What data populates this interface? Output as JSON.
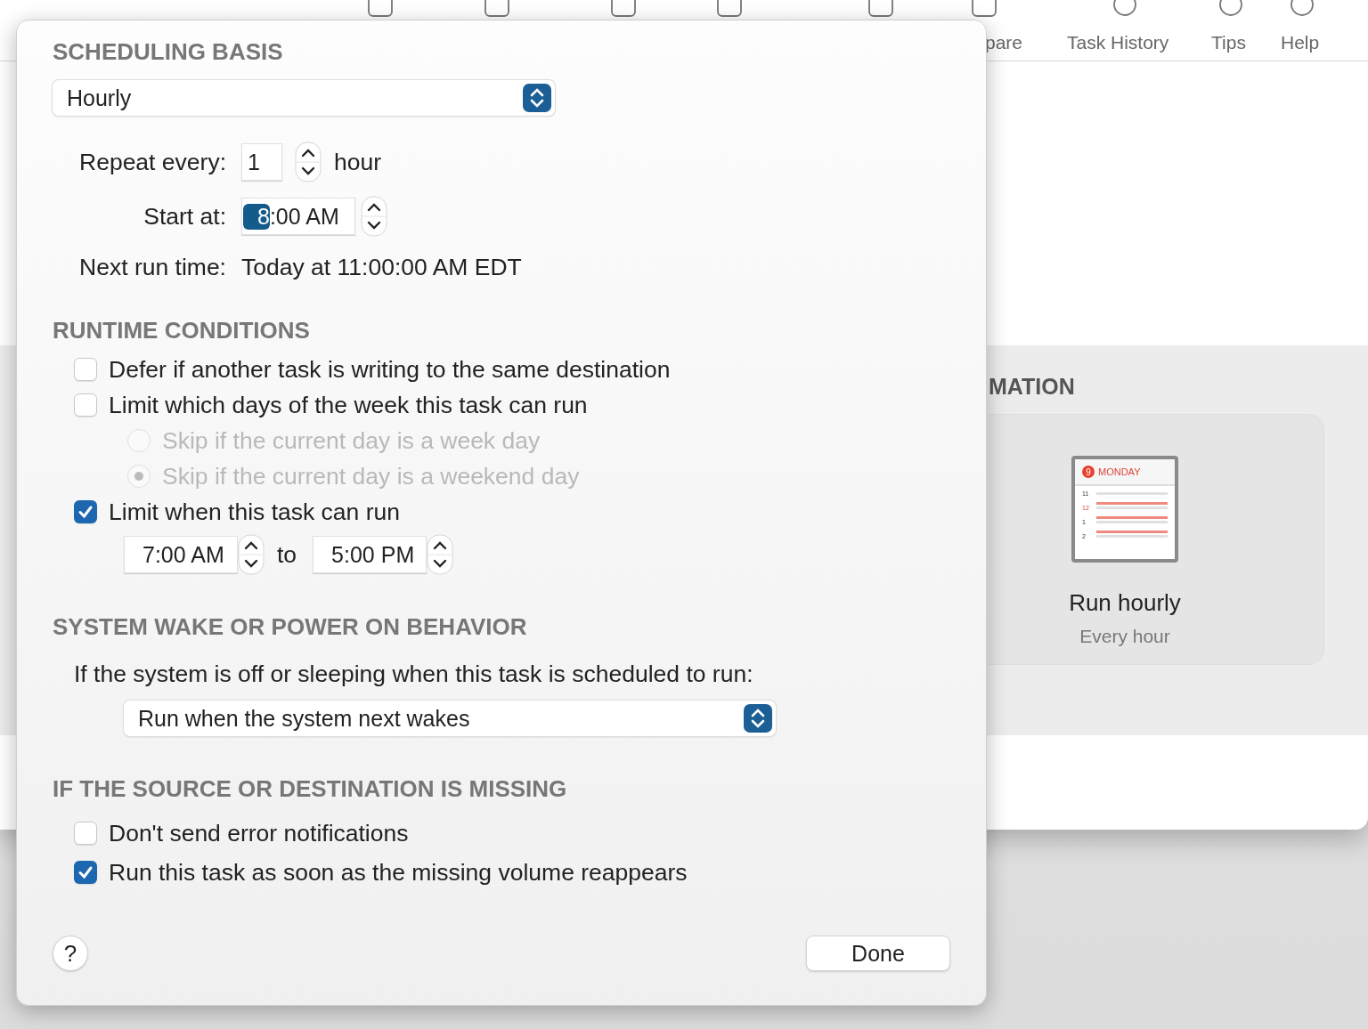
{
  "toolbar": {
    "labels": [
      "pare",
      "Task History",
      "Tips",
      "Help"
    ]
  },
  "background_panel": {
    "heading": "MATION",
    "card": {
      "calendar": {
        "badge": "9",
        "day": "MONDAY",
        "hours": [
          "11",
          "12",
          "1",
          "2"
        ]
      },
      "title": "Run hourly",
      "subtitle": "Every hour"
    }
  },
  "sheet": {
    "scheduling_basis": {
      "heading": "SCHEDULING BASIS",
      "select": "Hourly",
      "repeat_every": {
        "label": "Repeat every:",
        "value": "1",
        "unit": "hour"
      },
      "start_at": {
        "label": "Start at:",
        "hour": "8",
        "hour_selected": true,
        "rest": ":00 AM"
      },
      "next_run": {
        "label": "Next run time:",
        "value": "Today at 11:00:00 AM EDT"
      }
    },
    "runtime_conditions": {
      "heading": "RUNTIME CONDITIONS",
      "options": [
        {
          "kind": "checkbox",
          "label": "Defer if another task is writing to the same destination",
          "checked": false,
          "disabled": false
        },
        {
          "kind": "checkbox",
          "label": "Limit which days of the week this task can run",
          "checked": false,
          "disabled": false
        },
        {
          "kind": "radio",
          "label": "Skip if the current day is a week day",
          "selected": false,
          "disabled": true
        },
        {
          "kind": "radio",
          "label": "Skip if the current day is a weekend day",
          "selected": true,
          "disabled": true
        },
        {
          "kind": "checkbox",
          "label": "Limit when this task can run",
          "checked": true,
          "disabled": false
        },
        {
          "kind": "time_range",
          "from": "7:00 AM",
          "joiner": "to",
          "to": "5:00 PM"
        }
      ]
    },
    "wake_behavior": {
      "heading": "SYSTEM WAKE OR POWER ON BEHAVIOR",
      "description": "If the system is off or sleeping when this task is scheduled to run:",
      "select": "Run when the system next wakes"
    },
    "missing": {
      "heading": "IF THE SOURCE OR DESTINATION IS MISSING",
      "options": [
        {
          "kind": "checkbox",
          "label": "Don't send error notifications",
          "checked": false,
          "disabled": false
        },
        {
          "kind": "checkbox",
          "label": "Run this task as soon as the missing volume reappears",
          "checked": true,
          "disabled": false
        }
      ]
    },
    "footer": {
      "help": "?",
      "done": "Done"
    }
  }
}
